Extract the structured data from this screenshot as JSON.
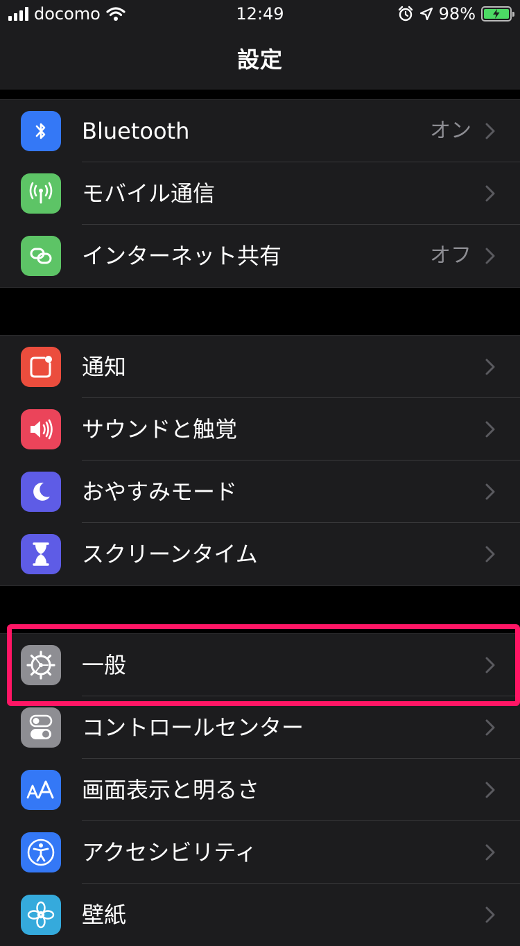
{
  "status": {
    "carrier": "docomo",
    "time": "12:49",
    "battery": "98%",
    "battery_level": 0.98
  },
  "nav": {
    "title": "設定"
  },
  "groups": [
    {
      "items": [
        {
          "label": "Bluetooth",
          "value": "オン",
          "icon": "bluetooth-icon",
          "color": "#3478f6"
        },
        {
          "label": "モバイル通信",
          "value": "",
          "icon": "antenna-icon",
          "color": "#5dc466"
        },
        {
          "label": "インターネット共有",
          "value": "オフ",
          "icon": "link-icon",
          "color": "#5dc466"
        }
      ]
    },
    {
      "items": [
        {
          "label": "通知",
          "icon": "notification-icon",
          "color": "#eb4d3d"
        },
        {
          "label": "サウンドと触覚",
          "icon": "speaker-icon",
          "color": "#eb445a"
        },
        {
          "label": "おやすみモード",
          "icon": "moon-icon",
          "color": "#5e5ce6"
        },
        {
          "label": "スクリーンタイム",
          "icon": "hourglass-icon",
          "color": "#5e5ce6"
        }
      ]
    },
    {
      "items": [
        {
          "label": "一般",
          "icon": "gear-icon",
          "color": "#8e8e93"
        },
        {
          "label": "コントロールセンター",
          "icon": "toggles-icon",
          "color": "#8e8e93"
        },
        {
          "label": "画面表示と明るさ",
          "icon": "text-size-icon",
          "color": "#3478f6"
        },
        {
          "label": "アクセシビリティ",
          "icon": "accessibility-icon",
          "color": "#3478f6"
        },
        {
          "label": "壁紙",
          "icon": "flower-icon",
          "color": "#35aadc"
        }
      ]
    }
  ]
}
